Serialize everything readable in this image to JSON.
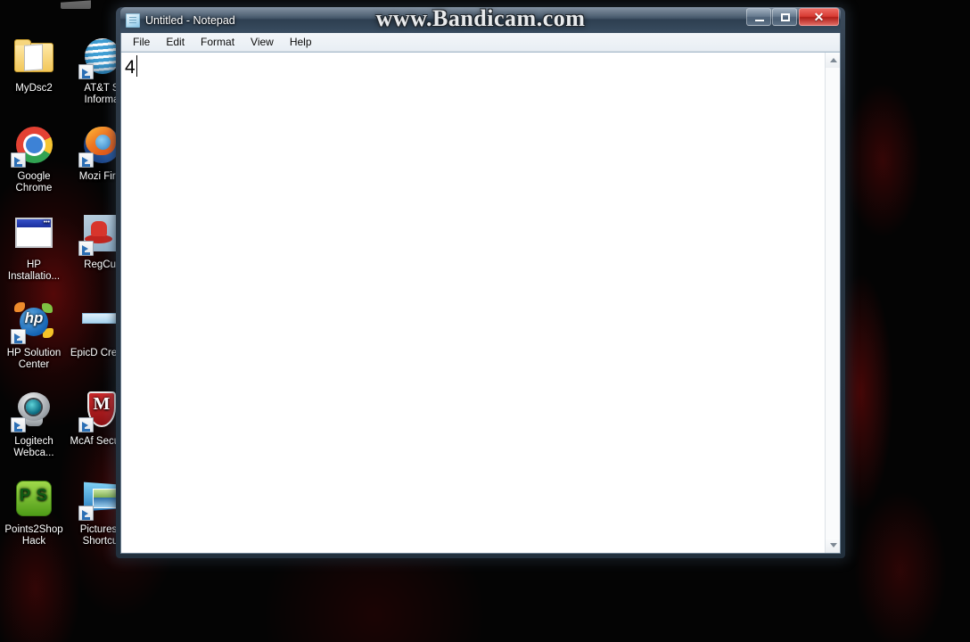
{
  "desktop": {
    "wallpaper_color": "#040404",
    "accent_color": "#8e1013",
    "icons": [
      {
        "label": "MyDsc2",
        "icon": "folder-icon",
        "shortcut": false
      },
      {
        "label": "AT&T S Informa",
        "icon": "att-globe-icon",
        "shortcut": true
      },
      {
        "label": "Google Chrome",
        "icon": "google-chrome-icon",
        "shortcut": true
      },
      {
        "label": "Mozi Firef",
        "icon": "mozilla-firefox-icon",
        "shortcut": true
      },
      {
        "label": "HP Installatio...",
        "icon": "window-icon",
        "shortcut": false
      },
      {
        "label": "RegCur",
        "icon": "regcure-hat-icon",
        "shortcut": true
      },
      {
        "label": "HP Solution Center",
        "icon": "hp-logo-icon",
        "shortcut": true
      },
      {
        "label": "EpicD Credits",
        "icon": "banner-icon",
        "shortcut": false
      },
      {
        "label": "Logitech Webca...",
        "icon": "webcam-icon",
        "shortcut": true
      },
      {
        "label": "McAf Security",
        "icon": "mcafee-shield-icon",
        "shortcut": true
      },
      {
        "label": "Points2Shop Hack",
        "icon": "points2shop-icon",
        "shortcut": false
      },
      {
        "label": "Pictures - Shortcut",
        "icon": "pictures-folder-icon",
        "shortcut": true
      }
    ]
  },
  "watermark": {
    "text": "www.Bandicam.com"
  },
  "notepad": {
    "title": "Untitled - Notepad",
    "icon": "notepad-icon",
    "window_buttons": {
      "minimize_label": "Minimize",
      "maximize_label": "Maximize",
      "close_label": "✕"
    },
    "menu": [
      {
        "label": "File"
      },
      {
        "label": "Edit"
      },
      {
        "label": "Format"
      },
      {
        "label": "View"
      },
      {
        "label": "Help"
      }
    ],
    "document": {
      "text": "4",
      "placeholder": ""
    },
    "scrollbar": {
      "up_arrow": "scroll-up-icon",
      "down_arrow": "scroll-down-icon"
    }
  }
}
